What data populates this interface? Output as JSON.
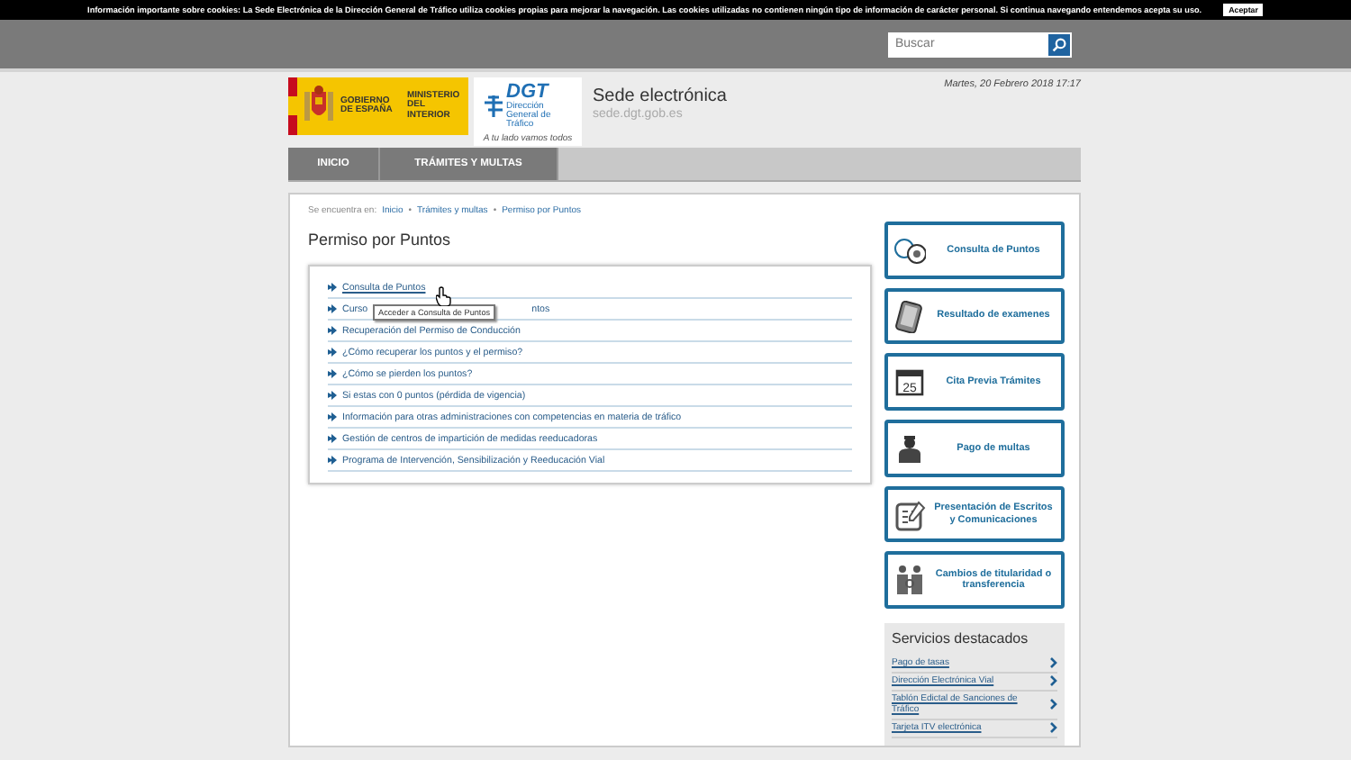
{
  "cookie_bar": {
    "text": "Información importante sobre cookies: La Sede Electrónica de la Dirección General de Tráfico utiliza cookies propias para mejorar la navegación. Las cookies utilizadas no contienen ningún tipo de información de carácter personal. Si continua navegando entendemos acepta su uso.",
    "button": "Aceptar"
  },
  "search": {
    "placeholder": "Buscar"
  },
  "header": {
    "gov_name": "GOBIERNO DE ESPAÑA",
    "ministry": "MINISTERIO DEL INTERIOR",
    "dgt_logo": "DGT",
    "dgt_sub": "Dirección General de Tráfico",
    "tagline": "A tu lado vamos todos",
    "site_title": "Sede electrónica",
    "site_url": "sede.dgt.gob.es",
    "date": "Martes, 20 Febrero 2018 17:17"
  },
  "nav": [
    {
      "label": "INICIO",
      "selected": false
    },
    {
      "label": "TRÁMITES Y MULTAS",
      "selected": false
    }
  ],
  "breadcrumb": {
    "prefix": "Se encuentra en:",
    "separator": "•",
    "items": [
      "Inicio",
      "Trámites y multas",
      "Permiso por Puntos"
    ]
  },
  "page_title": "Permiso por Puntos",
  "links": [
    {
      "label": "Consulta de Puntos",
      "hovered": true
    },
    {
      "label": "Curso",
      "tail": "ntos",
      "hovered": false
    },
    {
      "label": "Recuperación del Permiso de Conducción",
      "hovered": false
    },
    {
      "label": "¿Cómo recuperar los puntos y el permiso?",
      "hovered": false
    },
    {
      "label": "¿Cómo se pierden los puntos?",
      "hovered": false
    },
    {
      "label": "Si estas con 0 puntos (pérdida de vigencia)",
      "hovered": false
    },
    {
      "label": "Información para otras administraciones con competencias en materia de tráfico",
      "hovered": false
    },
    {
      "label": "Gestión de centros de impartición de medidas reeducadoras",
      "hovered": false
    },
    {
      "label": "Programa de Intervención, Sensibilización y Reeducación Vial",
      "hovered": false
    }
  ],
  "tooltip": "Acceder a Consulta de Puntos",
  "services": [
    {
      "kind": "points",
      "label": "Consulta de Puntos"
    },
    {
      "kind": "tablet",
      "label": "Resultado de examenes"
    },
    {
      "kind": "calendar",
      "label": "Cita Previa Trámites",
      "badge": "25"
    },
    {
      "kind": "officer",
      "label": "Pago de multas"
    },
    {
      "kind": "document",
      "label": "Presentación de Escritos y Comunicaciones"
    },
    {
      "kind": "people",
      "label": "Cambios de titularidad o transferencia"
    }
  ],
  "featured": {
    "title": "Servicios destacados",
    "items": [
      "Pago de tasas",
      "Dirección Electrónica Vial",
      "Tablón Edictal de Sanciones de Tráfico",
      "Tarjeta ITV electrónica"
    ]
  }
}
